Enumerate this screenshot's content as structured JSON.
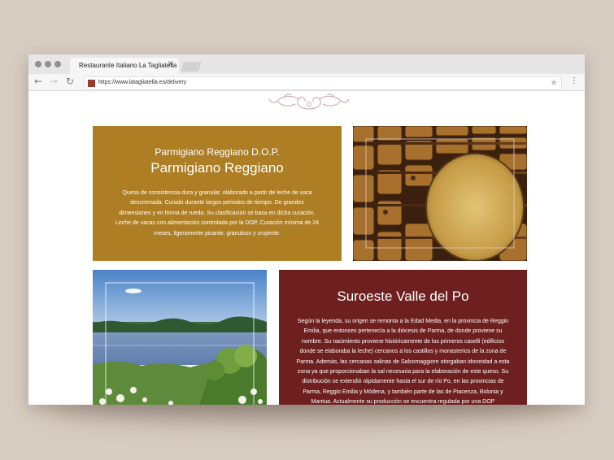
{
  "colors": {
    "background": "#d7ccc1",
    "gold_card": "#ae7e24",
    "red_card": "#6e1f1f",
    "ornament": "#c9a3a3"
  },
  "browser": {
    "tab_title": "Restaurante Italiano La Tagliatella",
    "url": "https://www.latagliatella.es/delivery",
    "icons": [
      "back-icon",
      "forward-icon",
      "reload-icon",
      "bookmark-star-icon",
      "menu-icon",
      "close-icon"
    ]
  },
  "cards": {
    "parmigiano": {
      "subtitle": "Parmigiano Reggiano D.O.P.",
      "title": "Parmigiano Reggiano",
      "body": "Queso de consistencia dura y granular, elaborado a partir de leche de vaca descremada. Curado durante largos periodos de tiempo. De grandes dimensiones y en forma de rueda. Su clasificación se basa en dicha curación. Leche de vacas con alimentación controlada por la DOP. Curación mínima de 24 meses, ligeramente picante, granuloso y crujiente."
    },
    "region": {
      "title": "Suroeste Valle del Po",
      "body": "Según la leyenda, su origen se remonta a la Edad Media, en la provincia de Reggio Emilia, que entonces pertenecía a la diócesis de Parma, de donde proviene su nombre. Su nacimiento proviene históricamente de los primeros caselli (edificios donde se elaboraba la leche) cercanos a los castillos y monasterios de la zona de Parma. Además, las cercanas salinas de Salsomaggiore otorgaban idoneidad a esta zona ya que proporcionaban la sal necesaria para la elaboración de este queso. Su distribución se extendió rápidamente hasta el sur de río Po, en las provincias de Parma, Reggio Emilia y Módena, y también parte de las de Piacenza, Bolonia y Mantua. Actualmente su producción se encuentra regulada por una DOP (Denominación de Origen"
    }
  }
}
